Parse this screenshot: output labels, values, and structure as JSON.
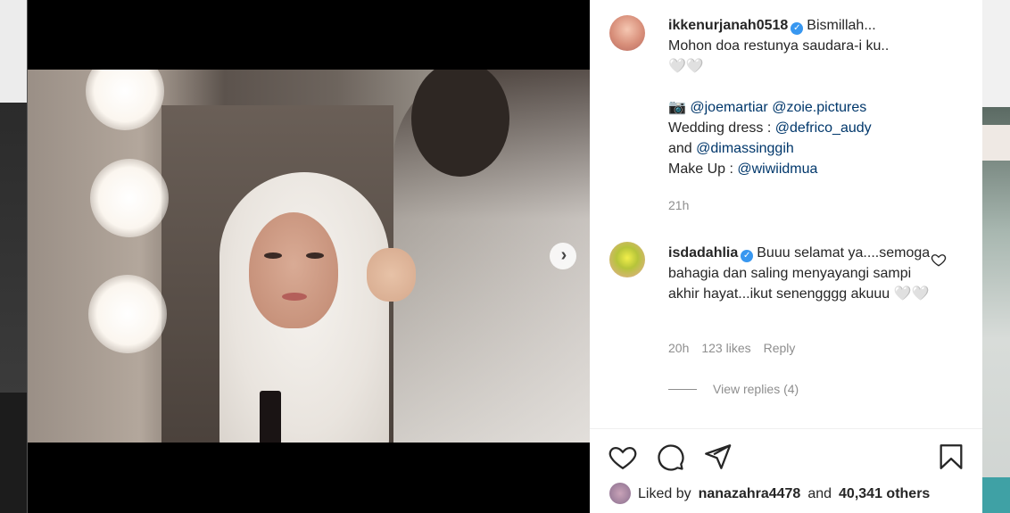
{
  "post": {
    "author": "ikkenurjanah0518",
    "caption_lines": [
      "Bismillah...",
      "Mohon doa restunya saudara-i ku..",
      "🤍🤍"
    ],
    "credits_icon": "📷",
    "credit_1": "@joemartiar",
    "credit_2": "@zoie.pictures",
    "wedding_label": "Wedding dress :",
    "wedding_1": "@defrico_audy",
    "and_label": "and",
    "wedding_2": "@dimassinggih",
    "makeup_label": "Make Up :",
    "makeup_1": "@wiwiidmua",
    "time": "21h"
  },
  "comment": {
    "author": "isdadahlia",
    "text": "Buuu selamat ya....semoga bahagia dan saling menyayangi sampi akhir hayat...ikut senengggg akuuu 🤍🤍",
    "time": "20h",
    "likes": "123 likes",
    "reply_label": "Reply",
    "view_replies": "View replies (4)"
  },
  "likes": {
    "prefix": "Liked by",
    "user": "nanazahra4478",
    "middle": "and",
    "count": "40,341 others"
  },
  "icons": {
    "verified": "verified-badge-icon",
    "next": "chevron-right-icon",
    "like": "heart-icon",
    "comment": "comment-icon",
    "share": "paper-plane-icon",
    "save": "bookmark-icon"
  },
  "colors": {
    "link": "#00376b",
    "verified": "#3897f0",
    "meta": "#8e8e8e"
  }
}
